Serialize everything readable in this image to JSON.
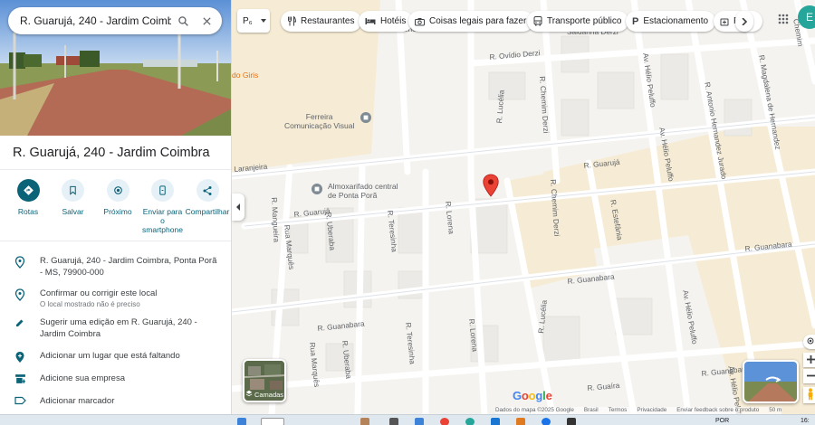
{
  "search": {
    "value": "R. Guarujá, 240 - Jardim Coimbra"
  },
  "place": {
    "title": "R. Guarujá, 240 - Jardim Coimbra"
  },
  "actions": [
    {
      "label": "Rotas",
      "icon": "directions-icon"
    },
    {
      "label": "Salvar",
      "icon": "bookmark-icon"
    },
    {
      "label": "Próximo",
      "icon": "nearby-icon"
    },
    {
      "label": "Enviar para o smartphone",
      "icon": "phone-icon"
    },
    {
      "label": "Compartilhar",
      "icon": "share-icon"
    }
  ],
  "info_rows": [
    {
      "text": "R. Guarujá, 240 - Jardim Coimbra, Ponta Porã - MS, 79900-000",
      "icon": "pin-icon"
    },
    {
      "text": "Confirmar ou corrigir este local",
      "sub": "O local mostrado não é preciso",
      "icon": "pin-check-icon"
    },
    {
      "text": "Sugerir uma edição em R. Guarujá, 240 - Jardim Coimbra",
      "icon": "pencil-icon"
    },
    {
      "text": "Adicionar um lugar que está faltando",
      "icon": "add-place-icon"
    },
    {
      "text": "Adicione sua empresa",
      "icon": "store-icon"
    },
    {
      "text": "Adicionar marcador",
      "icon": "label-icon"
    }
  ],
  "map_top": {
    "select_value": "P₆",
    "chips": [
      {
        "label": "Restaurantes",
        "icon": "fork-knife-icon"
      },
      {
        "label": "Hotéis",
        "icon": "bed-icon"
      },
      {
        "label": "Coisas legais para fazer",
        "icon": "camera-icon"
      },
      {
        "label": "Transporte público",
        "icon": "bus-icon"
      },
      {
        "label": "Estacionamento",
        "icon": "parking-icon"
      },
      {
        "label": "F",
        "icon": "pharmacy-icon"
      }
    ],
    "avatar_letter": "E"
  },
  "map_labels": {
    "streets": {
      "ovidio_derzi": "R. Ovídio Derzi",
      "chemim_derzi": "R. Chemim Derzi",
      "chemim_derzi_2": "R. Chemim Derzi",
      "chemim_top": "Chemim",
      "helio_peluffo": "Av. Hélio Peluffo",
      "helio_peluffo_2": "Av. Hélio Peluffo",
      "helio_peluffo_3": "Av. Hélio Peluffo",
      "helio_peluffo_4": "Av. Hélio Peluffo",
      "antonio_hernandez": "R. Antonio Hernandez Jurado",
      "magdalena": "R. Magdalena de Hernandez",
      "lucelia": "R. Lucélia",
      "lucelia_2": "R. Lucélia",
      "guaruja": "R. Guarujá",
      "guaruja_2": "R. Guarujá",
      "laranjeira": "Laranjeira",
      "mangueira": "R. Mangueira",
      "uberaba": "R. Uberaba",
      "uberaba_2": "R. Uberaba",
      "teresinha": "R. Teresinha",
      "teresinha_2": "R. Teresinha",
      "lorena": "R. Lorena",
      "lorena_2": "R. Lorena",
      "estefania": "R. Estefânia",
      "guanabara": "R. Guanabara",
      "guanabara_2": "R. Guanabara",
      "guanabara_3": "R. Guanabara",
      "guanabara_4": "R. Guanabara",
      "marques": "Rua Marquês",
      "marques_2": "Rua Marquês",
      "guaira": "R. Guaíra",
      "saldanha": "Saldanha Derzi"
    },
    "pois": {
      "ferreira": "Ferreira\nComunicação Visual",
      "almoxarifado": "Almoxarifado central\nde Ponta Porã",
      "giris": "do Giris",
      "residencial": "Residencial Inovare"
    }
  },
  "layers": {
    "label": "Camadas"
  },
  "google_logo": "Google",
  "attribution": [
    "Dados do mapa ©2025 Google",
    "Brasil",
    "Termos",
    "Privacidade",
    "Enviar feedback sobre o produto",
    "50 m"
  ],
  "taskbar": {
    "lang": "POR",
    "time": "16:"
  }
}
